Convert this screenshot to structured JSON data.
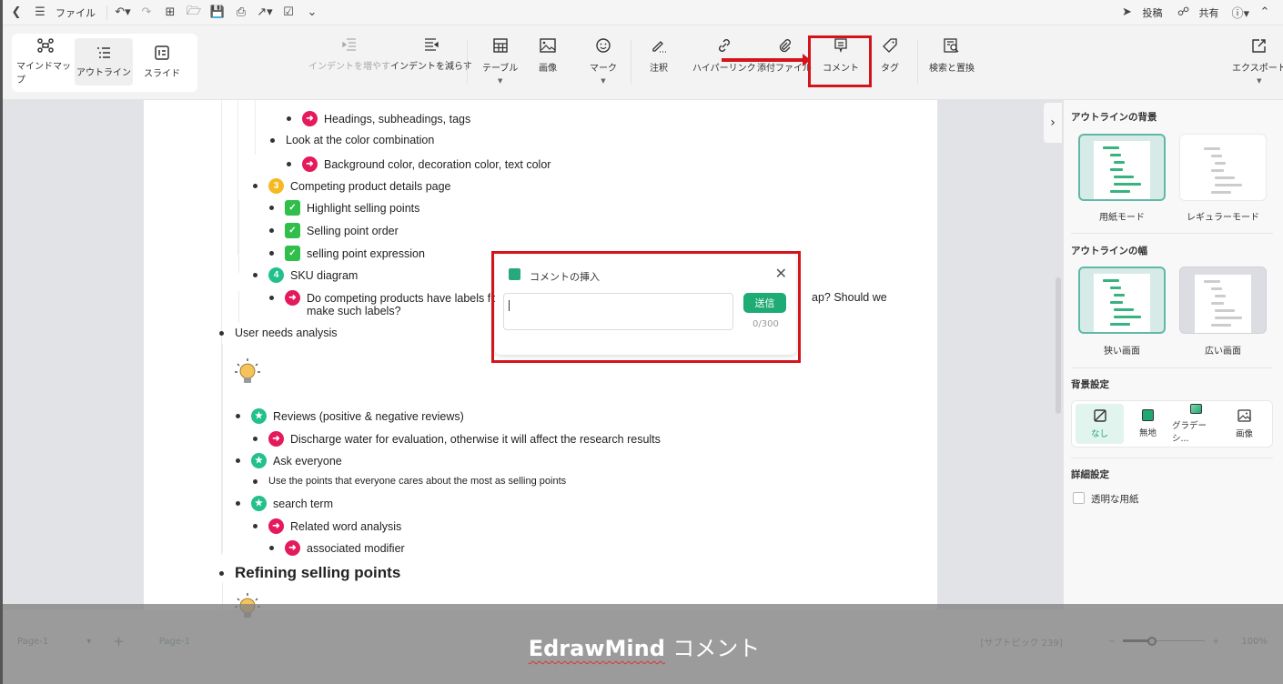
{
  "titlebar": {
    "file_menu": "ファイル",
    "post": "投稿",
    "share": "共有"
  },
  "ribbon": {
    "view_modes": [
      {
        "label": "マインドマップ",
        "icon": "mindmap-icon",
        "active": false
      },
      {
        "label": "アウトライン",
        "icon": "outline-icon",
        "active": true
      },
      {
        "label": "スライド",
        "icon": "slide-icon",
        "active": false
      }
    ],
    "indent_increase": "インデントを増やす",
    "indent_decrease": "インデントを減らす",
    "table": "テーブル",
    "image": "画像",
    "mark": "マーク",
    "note": "注釈",
    "hyperlink": "ハイパーリンク",
    "attachment": "添付ファイル",
    "comment": "コメント",
    "tag": "タグ",
    "find_replace": "検索と置換",
    "export": "エクスポート"
  },
  "outline": [
    {
      "text": "Headings, subheadings, tags",
      "marker": "arrow"
    },
    {
      "text": "Look at the color combination",
      "marker": "none"
    },
    {
      "text": "Background color, decoration color, text color",
      "marker": "arrow"
    },
    {
      "text": "Competing product details page",
      "marker": "3"
    },
    {
      "text": "Highlight selling points",
      "marker": "check"
    },
    {
      "text": "Selling point order",
      "marker": "check"
    },
    {
      "text": "selling point expression",
      "marker": "check"
    },
    {
      "text": "SKU diagram",
      "marker": "4"
    },
    {
      "text": "Do competing products have labels fo",
      "marker": "arrow"
    },
    {
      "text": "make such labels?",
      "marker": "none"
    },
    {
      "text": "ap? Should we",
      "marker": "none"
    },
    {
      "text": "User needs analysis",
      "marker": "none"
    },
    {
      "text": "Reviews (positive & negative reviews)",
      "marker": "star"
    },
    {
      "text": "Discharge water for evaluation, otherwise it will affect the research results",
      "marker": "arrow"
    },
    {
      "text": "Ask everyone",
      "marker": "star"
    },
    {
      "text": "Use the points that everyone cares about the most as selling points",
      "marker": "none"
    },
    {
      "text": "search term",
      "marker": "star"
    },
    {
      "text": "Related word analysis",
      "marker": "arrow"
    },
    {
      "text": "associated modifier",
      "marker": "arrow"
    },
    {
      "text": "Refining selling points",
      "marker": "none"
    }
  ],
  "comment_dialog": {
    "title": "コメントの挿入",
    "input_value": "",
    "send_label": "送信",
    "counter": "0/300"
  },
  "panel": {
    "background_heading": "アウトラインの背景",
    "paper_mode": "用紙モード",
    "regular_mode": "レギュラーモード",
    "width_heading": "アウトラインの幅",
    "narrow": "狭い画面",
    "wide": "広い画面",
    "bg_settings_heading": "背景設定",
    "bg_options": [
      {
        "label": "なし",
        "selected": true
      },
      {
        "label": "無地",
        "selected": false
      },
      {
        "label": "グラデーシ...",
        "selected": false
      },
      {
        "label": "画像",
        "selected": false
      }
    ],
    "detail_heading": "詳細設定",
    "transparent_paper": "透明な用紙",
    "transparent_checked": false
  },
  "statusbar": {
    "page_select": "Page-1",
    "page_tab": "Page-1",
    "topic_count": "[サブトピック 239]",
    "zoom_level": "100%",
    "zoom_fraction": 0.35
  },
  "caption": {
    "brand": "EdrawMind",
    "text": "コメント"
  },
  "colors": {
    "accent": "#1fab74",
    "highlight_red": "#d4141b",
    "arrow_marker": "#e5195b",
    "number3_marker": "#f5b921",
    "number4_marker": "#22c08c"
  }
}
